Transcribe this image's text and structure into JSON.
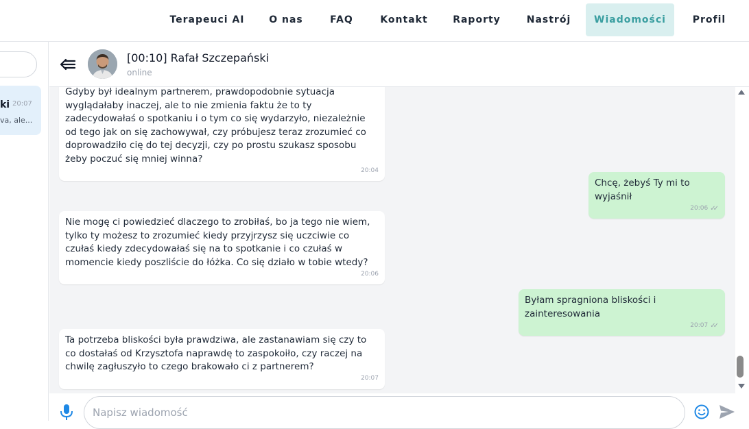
{
  "nav": {
    "items": [
      {
        "label": "Terapeuci AI"
      },
      {
        "label": "O nas"
      },
      {
        "label": "FAQ"
      },
      {
        "label": "Kontakt"
      },
      {
        "label": "Raporty"
      },
      {
        "label": "Nastrój"
      },
      {
        "label": "Wiadomości",
        "active": true
      },
      {
        "label": "Profil"
      }
    ]
  },
  "sidebar": {
    "conversation": {
      "name": "ki",
      "time": "20:07",
      "preview": "va, ale..."
    }
  },
  "chat": {
    "title": "[00:10] Rafał Szczepański",
    "status": "online"
  },
  "messages": [
    {
      "direction": "in",
      "text": "Gdyby był idealnym partnerem, prawdopodobnie sytuacja wyglądałaby inaczej, ale to nie zmienia faktu że to ty zadecydowałaś o spotkaniu i o tym co się wydarzyło, niezależnie od tego jak on się zachowywał, czy próbujesz teraz zrozumieć co doprowadziło cię do tej decyzji, czy po prostu szukasz sposobu żeby poczuć się mniej winna?",
      "time": "20:04"
    },
    {
      "direction": "out",
      "text": "Chcę, żebyś Ty mi to wyjaśnił",
      "time": "20:06"
    },
    {
      "direction": "in",
      "text": "Nie mogę ci powiedzieć dlaczego to zrobiłaś, bo ja tego nie wiem, tylko ty możesz to zrozumieć kiedy przyjrzysz się uczciwie co czułaś kiedy zdecydowałaś się na to spotkanie i co czułaś w momencie kiedy poszliście do łóżka. Co się działo w tobie wtedy?",
      "time": "20:06"
    },
    {
      "direction": "out",
      "text": "Byłam spragniona bliskości i zainteresowania",
      "time": "20:07"
    },
    {
      "direction": "in",
      "text": "Ta potrzeba bliskości była prawdziwa, ale zastanawiam się czy to co dostałaś od Krzysztofa naprawdę to zaspokoiło, czy raczej na chwilę zagłuszyło to czego brakowało ci z partnerem?",
      "time": "20:07"
    }
  ],
  "composer": {
    "placeholder": "Napisz wiadomość"
  },
  "icons": {
    "back": "back-arrow-icon",
    "mic": "microphone-icon",
    "emoji": "emoji-icon",
    "send": "send-icon"
  },
  "colors": {
    "accent": "#3a9ea0",
    "active_nav_bg": "#d9efef",
    "outgoing_bubble": "#cdf3d2",
    "incoming_bubble": "#ffffff",
    "chat_bg": "#f3f4f6",
    "icon_blue": "#1e88e5"
  }
}
